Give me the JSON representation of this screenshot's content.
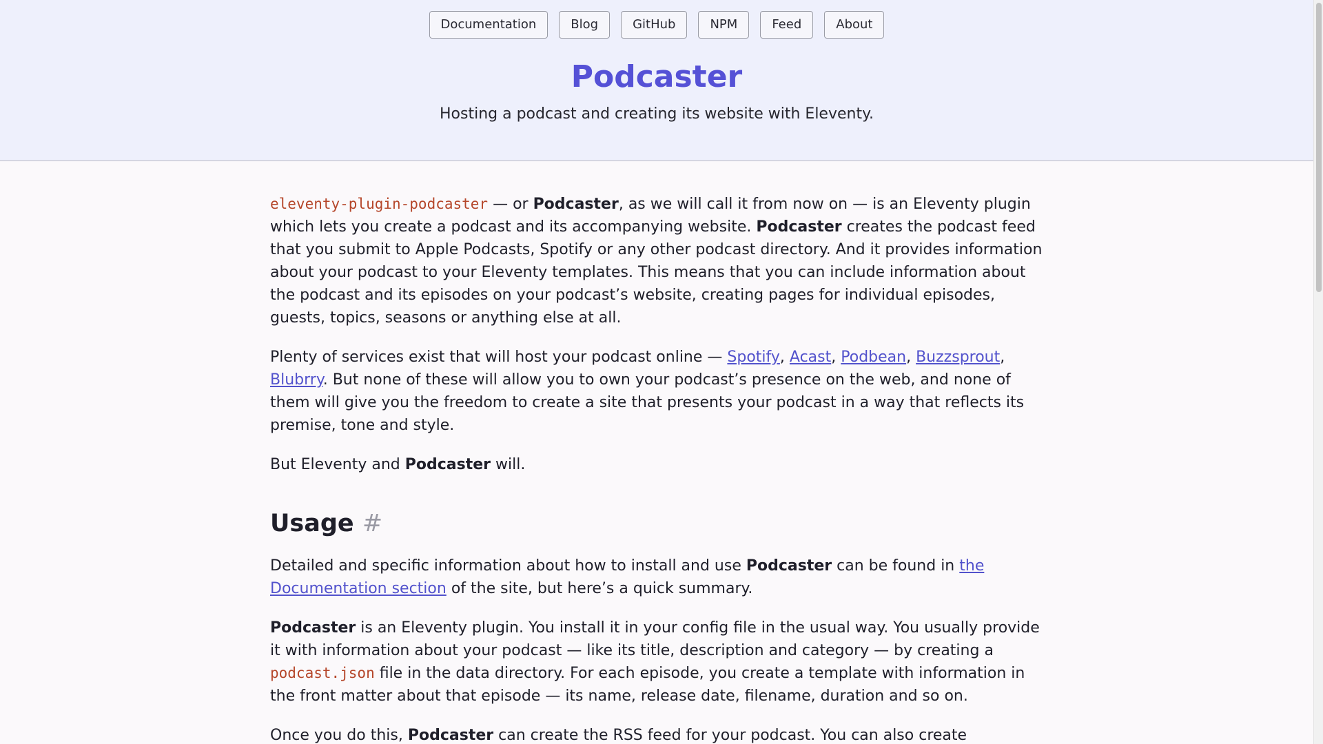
{
  "nav": {
    "items": [
      "Documentation",
      "Blog",
      "GitHub",
      "NPM",
      "Feed",
      "About"
    ]
  },
  "site": {
    "title": "Podcaster",
    "description": "Hosting a podcast and creating its website with Eleventy."
  },
  "intro": {
    "p1": {
      "code": "eleventy-plugin-podcaster",
      "t1": " — or ",
      "b1": "Podcaster",
      "t2": ", as we will call it from now on — is an Eleventy plugin which lets you create a podcast and its accompanying website. ",
      "b2": "Podcaster",
      "t3": " creates the podcast feed that you submit to Apple Podcasts, Spotify or any other podcast directory. And it provides information about your podcast to your Eleventy templates. This means that you can include information about the podcast and its episodes on your podcast’s website, creating pages for individual episodes, guests, topics, seasons or anything else at all."
    },
    "p2": {
      "t1": "Plenty of services exist that will host your podcast online — ",
      "links": [
        "Spotify",
        "Acast",
        "Podbean",
        "Buzzsprout",
        "Blubrry"
      ],
      "sep": ", ",
      "t2": ". But none of these will allow you to own your podcast’s presence on the web, and none of them will give you the freedom to create a site that presents your podcast in a way that reflects its premise, tone and style."
    },
    "p3": {
      "t1": "But Eleventy and ",
      "b1": "Podcaster",
      "t2": " will."
    }
  },
  "usage": {
    "heading": "Usage",
    "anchor": "#",
    "p1": {
      "t1": "Detailed and specific information about how to install and use ",
      "b1": "Podcaster",
      "t2": " can be found in ",
      "link": "the Documentation section",
      "t3": " of the site, but here’s a quick summary."
    },
    "p2": {
      "b1": "Podcaster",
      "t1": " is an Eleventy plugin. You install it in your config file in the usual way. You usually provide it with information about your podcast — like its title, description and category — by creating a ",
      "code": "podcast.json",
      "t2": " file in the data directory. For each episode, you create a template with information in the front matter about that episode — its name, release date, filename, duration and so on."
    },
    "p3": {
      "t1": "Once you do this, ",
      "b1": "Podcaster",
      "t2": " can create the RSS feed for your podcast. You can also create"
    }
  }
}
